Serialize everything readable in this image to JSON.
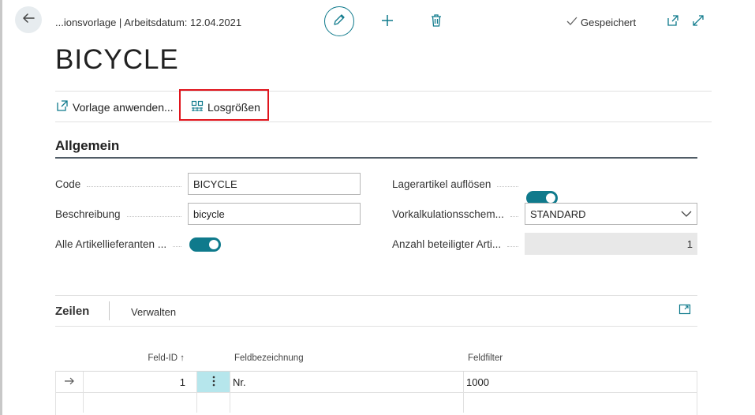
{
  "header": {
    "breadcrumb": "...ionsvorlage | Arbeitsdatum: 12.04.2021",
    "saved_status": "Gespeichert"
  },
  "page": {
    "title": "BICYCLE"
  },
  "actions": {
    "apply_template": "Vorlage anwenden...",
    "lot_sizes": "Losgrößen"
  },
  "general": {
    "section_title": "Allgemein",
    "code_label": "Code",
    "code_value": "BICYCLE",
    "description_label": "Beschreibung",
    "description_value": "bicycle",
    "all_vendors_label": "Alle Artikellieferanten ...",
    "explode_inventory_label": "Lagerartikel auflösen",
    "costing_method_label": "Vorkalkulationsschem...",
    "costing_method_value": "STANDARD",
    "items_count_label": "Anzahl beteiligter Arti...",
    "items_count_value": "1"
  },
  "lines": {
    "title": "Zeilen",
    "manage": "Verwalten",
    "columns": {
      "field_id": "Feld-ID",
      "field_id_sort": "↑",
      "field_caption": "Feldbezeichnung",
      "field_filter": "Feldfilter"
    },
    "rows": [
      {
        "field_id": "1",
        "field_caption": "Nr.",
        "field_filter": "1000"
      }
    ]
  },
  "colors": {
    "accent": "#0f7a8c",
    "highlight_box": "#e0141c",
    "selected_cell": "#b6e6ec"
  }
}
